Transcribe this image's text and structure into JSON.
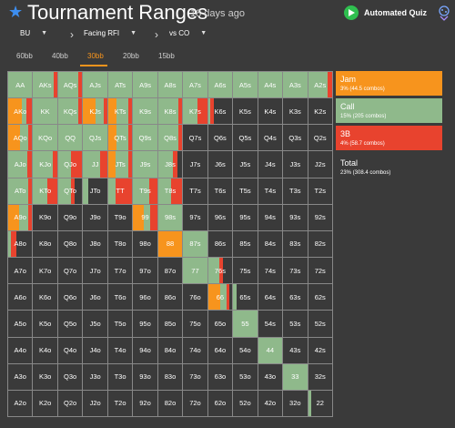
{
  "header": {
    "title": "Tournament Ranges",
    "subtitle": "18 days ago",
    "quiz_label": "Automated Quiz"
  },
  "selectors": {
    "position": "BU",
    "situation": "Facing RFI",
    "opponent": "vs CO"
  },
  "tabs": [
    "60bb",
    "40bb",
    "30bb",
    "20bb",
    "15bb"
  ],
  "active_tab": "30bb",
  "colors": {
    "jam": "#f7941d",
    "call": "#8fb98b",
    "threebet": "#e8432e",
    "fold": "#3a3a3a",
    "accent": "#f7941d",
    "grid_line": "#888888"
  },
  "legend": {
    "jam": {
      "name": "Jam",
      "value": "3% (44.5 combos)"
    },
    "call": {
      "name": "Call",
      "value": "15% (205 combos)"
    },
    "threebet": {
      "name": "3B",
      "value": "4% (58.7 combos)"
    },
    "total": {
      "name": "Total",
      "value": "23% (308.4 combos)"
    }
  },
  "hands": [
    [
      "AA",
      "AKs",
      "AQs",
      "AJs",
      "ATs",
      "A9s",
      "A8s",
      "A7s",
      "A6s",
      "A5s",
      "A4s",
      "A3s",
      "A2s"
    ],
    [
      "AKo",
      "KK",
      "KQs",
      "KJs",
      "KTs",
      "K9s",
      "K8s",
      "K7s",
      "K6s",
      "K5s",
      "K4s",
      "K3s",
      "K2s"
    ],
    [
      "AQo",
      "KQo",
      "QQ",
      "QJs",
      "QTs",
      "Q9s",
      "Q8s",
      "Q7s",
      "Q6s",
      "Q5s",
      "Q4s",
      "Q3s",
      "Q2s"
    ],
    [
      "AJo",
      "KJo",
      "QJo",
      "JJ",
      "JTs",
      "J9s",
      "J8s",
      "J7s",
      "J6s",
      "J5s",
      "J4s",
      "J3s",
      "J2s"
    ],
    [
      "ATo",
      "KTo",
      "QTo",
      "JTo",
      "TT",
      "T9s",
      "T8s",
      "T7s",
      "T6s",
      "T5s",
      "T4s",
      "T3s",
      "T2s"
    ],
    [
      "A9o",
      "K9o",
      "Q9o",
      "J9o",
      "T9o",
      "99",
      "98s",
      "97s",
      "96s",
      "95s",
      "94s",
      "93s",
      "92s"
    ],
    [
      "A8o",
      "K8o",
      "Q8o",
      "J8o",
      "T8o",
      "98o",
      "88",
      "87s",
      "86s",
      "85s",
      "84s",
      "83s",
      "82s"
    ],
    [
      "A7o",
      "K7o",
      "Q7o",
      "J7o",
      "T7o",
      "97o",
      "87o",
      "77",
      "76s",
      "75s",
      "74s",
      "73s",
      "72s"
    ],
    [
      "A6o",
      "K6o",
      "Q6o",
      "J6o",
      "T6o",
      "96o",
      "86o",
      "76o",
      "66",
      "65s",
      "64s",
      "63s",
      "62s"
    ],
    [
      "A5o",
      "K5o",
      "Q5o",
      "J5o",
      "T5o",
      "95o",
      "85o",
      "75o",
      "65o",
      "55",
      "54s",
      "53s",
      "52s"
    ],
    [
      "A4o",
      "K4o",
      "Q4o",
      "J4o",
      "T4o",
      "94o",
      "84o",
      "74o",
      "64o",
      "54o",
      "44",
      "43s",
      "42s"
    ],
    [
      "A3o",
      "K3o",
      "Q3o",
      "J3o",
      "T3o",
      "93o",
      "83o",
      "73o",
      "63o",
      "53o",
      "43o",
      "33",
      "32s"
    ],
    [
      "A2o",
      "K2o",
      "Q2o",
      "J2o",
      "T2o",
      "92o",
      "82o",
      "72o",
      "62o",
      "52o",
      "42o",
      "32o",
      "22"
    ]
  ],
  "frequencies": {
    "AA": {
      "call": 1.0
    },
    "AKs": {
      "call": 0.85,
      "threebet": 0.15
    },
    "AQs": {
      "call": 0.85,
      "threebet": 0.15
    },
    "AJs": {
      "call": 1.0
    },
    "ATs": {
      "call": 1.0
    },
    "A9s": {
      "call": 1.0
    },
    "A8s": {
      "call": 1.0
    },
    "A7s": {
      "call": 1.0
    },
    "A6s": {
      "call": 1.0
    },
    "A5s": {
      "call": 1.0
    },
    "A4s": {
      "call": 1.0
    },
    "A3s": {
      "call": 1.0
    },
    "A2s": {
      "call": 0.8,
      "threebet": 0.2
    },
    "AKo": {
      "jam": 0.55,
      "call": 0.2,
      "threebet": 0.25
    },
    "KK": {
      "call": 1.0
    },
    "KQs": {
      "call": 0.85,
      "threebet": 0.15
    },
    "KJs": {
      "jam": 0.5,
      "call": 0.35,
      "threebet": 0.15
    },
    "KTs": {
      "jam": 0.35,
      "call": 0.5,
      "threebet": 0.15
    },
    "K9s": {
      "call": 1.0
    },
    "K8s": {
      "call": 0.85,
      "threebet": 0.15
    },
    "K7s": {
      "call": 0.6,
      "threebet": 0.4
    },
    "K6s": {
      "call": 0.1,
      "threebet": 0.15
    },
    "AQo": {
      "jam": 0.5,
      "call": 0.35,
      "threebet": 0.15
    },
    "KQo": {
      "call": 1.0
    },
    "QQ": {
      "call": 1.0
    },
    "QJs": {
      "call": 1.0
    },
    "QTs": {
      "jam": 0.35,
      "call": 0.5,
      "threebet": 0.15
    },
    "Q9s": {
      "call": 1.0
    },
    "Q8s": {
      "call": 0.85,
      "threebet": 0.15
    },
    "AJo": {
      "call": 0.8,
      "threebet": 0.2
    },
    "KJo": {
      "call": 0.8,
      "threebet": 0.2
    },
    "QJo": {
      "call": 0.55,
      "threebet": 0.45
    },
    "JJ": {
      "call": 0.7,
      "threebet": 0.3
    },
    "JTs": {
      "jam": 0.3,
      "call": 0.55,
      "threebet": 0.15
    },
    "J9s": {
      "call": 1.0
    },
    "J8s": {
      "call": 0.6,
      "threebet": 0.2
    },
    "ATo": {
      "call": 0.85,
      "threebet": 0.15
    },
    "KTo": {
      "call": 0.6,
      "threebet": 0.4
    },
    "QTo": {
      "call": 0.55,
      "threebet": 0.15
    },
    "JTo": {
      "call": 0.2
    },
    "TT": {
      "call": 0.3,
      "threebet": 0.7
    },
    "T9s": {
      "call": 0.65,
      "threebet": 0.35
    },
    "T8s": {
      "call": 0.55,
      "threebet": 0.45
    },
    "A9o": {
      "jam": 0.45,
      "call": 0.4,
      "threebet": 0.15
    },
    "99": {
      "jam": 0.45,
      "call": 0.25,
      "threebet": 0.3
    },
    "98s": {
      "call": 1.0
    },
    "A8o": {
      "call": 0.1,
      "threebet": 0.25
    },
    "88": {
      "jam": 1.0
    },
    "87s": {
      "call": 1.0
    },
    "77": {
      "call": 1.0
    },
    "76s": {
      "call": 0.45,
      "threebet": 0.15
    },
    "66": {
      "jam": 0.5,
      "call": 0.25,
      "threebet": 0.15
    },
    "65s": {
      "call": 0.15
    },
    "55": {
      "call": 1.0
    },
    "44": {
      "call": 1.0
    },
    "33": {
      "call": 1.0
    },
    "22": {
      "call": 0.15
    }
  }
}
